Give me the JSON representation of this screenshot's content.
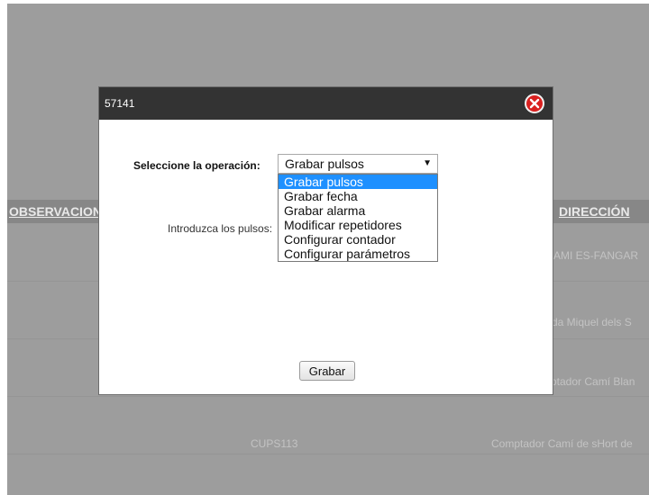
{
  "background": {
    "headers": [
      "OBSERVACIONES",
      "DIRECCIÓN"
    ],
    "rows": [
      {
        "text": "AMI ES-FANGAR"
      },
      {
        "text": "da Miquel dels S"
      },
      {
        "text": "ptador Camí Blan"
      },
      {
        "col1": "CUPS113",
        "col2": "Comptador Camí de sHort de"
      }
    ]
  },
  "modal": {
    "title": "57141",
    "close_icon": "close-icon",
    "operation_label": "Seleccione la operación:",
    "selected_value": "Grabar pulsos",
    "options": [
      "Grabar pulsos",
      "Grabar fecha",
      "Grabar alarma",
      "Modificar repetidores",
      "Configurar contador",
      "Configurar parámetros"
    ],
    "selected_index": 0,
    "pulses_label": "Introduzca los pulsos:",
    "submit_label": "Grabar"
  },
  "colors": {
    "overlay": "#9d9d9d",
    "header_bar": "#333333",
    "close": "#d9201f",
    "highlight": "#1e90ff"
  }
}
